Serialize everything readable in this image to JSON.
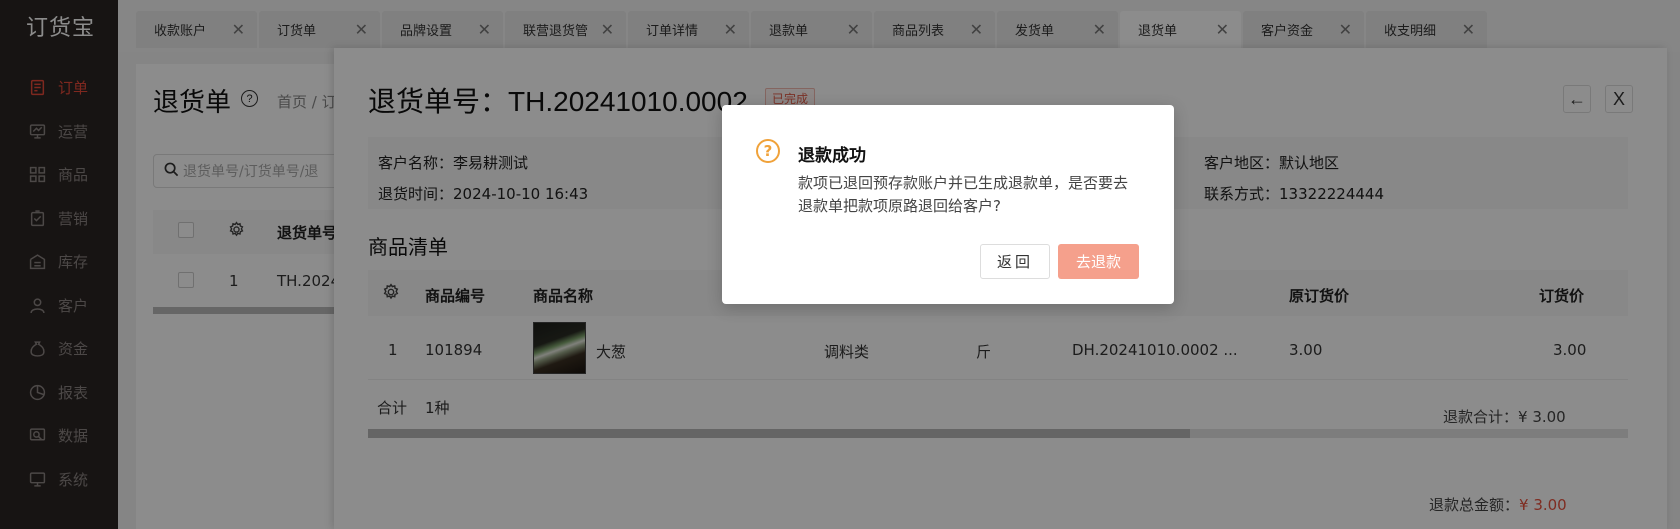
{
  "app": {
    "logo": "订货宝"
  },
  "sidebar": {
    "items": [
      {
        "label": "订单",
        "icon": "order-icon",
        "active": true
      },
      {
        "label": "运营",
        "icon": "operation-icon"
      },
      {
        "label": "商品",
        "icon": "product-icon"
      },
      {
        "label": "营销",
        "icon": "marketing-icon"
      },
      {
        "label": "库存",
        "icon": "warehouse-icon"
      },
      {
        "label": "客户",
        "icon": "customer-icon"
      },
      {
        "label": "资金",
        "icon": "money-bag-icon"
      },
      {
        "label": "报表",
        "icon": "pie-chart-icon"
      },
      {
        "label": "数据",
        "icon": "data-icon"
      },
      {
        "label": "系统",
        "icon": "monitor-icon"
      }
    ]
  },
  "tabs": [
    {
      "label": "收款账户"
    },
    {
      "label": "订货单"
    },
    {
      "label": "品牌设置"
    },
    {
      "label": "联营退货管"
    },
    {
      "label": "订单详情"
    },
    {
      "label": "退款单"
    },
    {
      "label": "商品列表"
    },
    {
      "label": "发货单"
    },
    {
      "label": "退货单",
      "active": true
    },
    {
      "label": "客户资金"
    },
    {
      "label": "收支明细"
    }
  ],
  "background_page": {
    "title": "退货单",
    "breadcrumb": "首页 / 订",
    "search_placeholder": "退货单号/订货单号/退",
    "col_no": "退货单号",
    "row_index": "1",
    "row_no": "TH.2024"
  },
  "drawer": {
    "title_prefix": "退货单号：",
    "title_number": "TH.20241010.0002",
    "status_badge": "已完成",
    "back_glyph": "←",
    "close_glyph": "X",
    "customer_name_label": "客户名称：",
    "customer_name": "李易耕测试",
    "return_time_label": "退货时间：",
    "return_time": "2024-10-10 16:43",
    "region_label": "客户地区：",
    "region": "默认地区",
    "contact_label": "联系方式：",
    "contact": "13322224444",
    "section_title": "商品清单",
    "table": {
      "headers": {
        "code": "商品编号",
        "name": "商品名称",
        "orig_price": "原订货价",
        "order_price": "订货价"
      },
      "rows": [
        {
          "index": "1",
          "code": "101894",
          "name": "大葱",
          "category": "调料类",
          "unit": "斤",
          "order_no": "DH.20241010.0002 ...",
          "orig_price": "3.00",
          "order_price": "3.00"
        }
      ],
      "footer_label": "合计",
      "footer_count": "1种"
    },
    "refund_total_label": "退款合计：",
    "refund_total": "¥ 3.00",
    "refund_grand_label": "退款总金额：",
    "refund_grand": "¥ 3.00"
  },
  "modal": {
    "icon": "question-icon",
    "title": "退款成功",
    "content": "款项已退回预存款账户并已生成退款单，是否要去退款单把款项原路退回给客户?",
    "back_label": "返回",
    "confirm_label": "去退款"
  },
  "colors": {
    "accent": "#e84a3a",
    "confirm": "#f5a08c",
    "warning": "#f0a23a"
  }
}
